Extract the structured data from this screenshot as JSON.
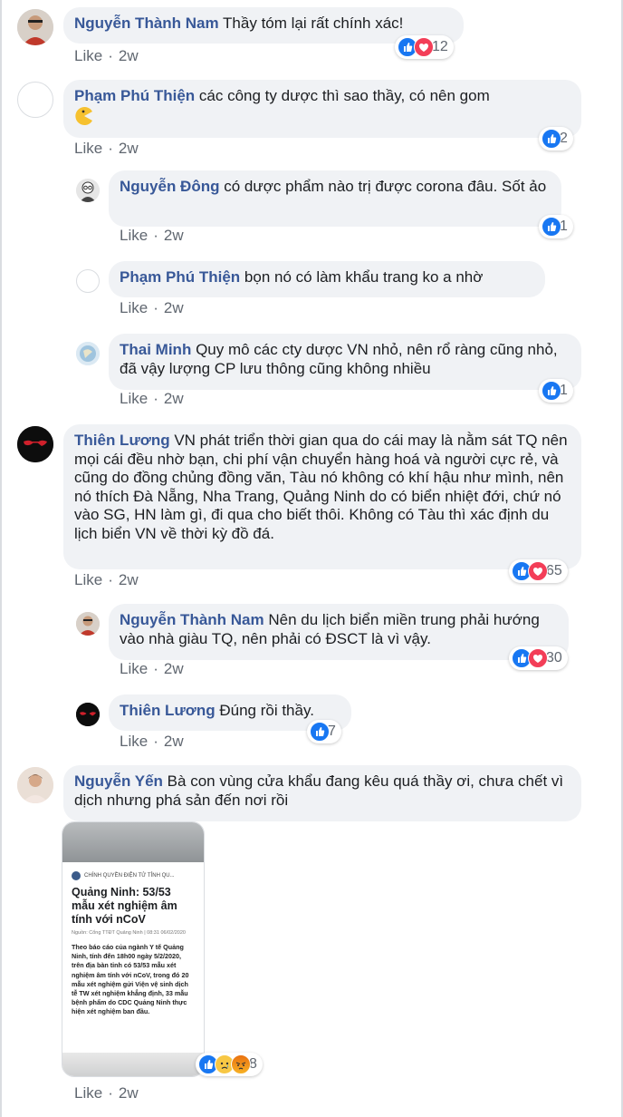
{
  "colors": {
    "name": "#385898",
    "like": "#1877f2",
    "love": "#f33e58",
    "meta": "#606770",
    "bubble": "#f0f2f5"
  },
  "comments": [
    {
      "name": "Nguyễn Thành Nam",
      "text": "Thầy tóm lại rất chính xác!",
      "like": "Like",
      "time": "2w",
      "reactions": [
        "like",
        "love"
      ],
      "count": "12"
    },
    {
      "name": "Phạm Phú Thiện",
      "text": "các công ty dược thì sao thầy, có nên gom",
      "emoji": "pacman-icon",
      "like": "Like",
      "time": "2w",
      "reactions": [
        "like"
      ],
      "count": "2"
    },
    {
      "name": "Nguyễn Đông",
      "text": "có dược phẩm nào trị được corona đâu. Sốt ảo",
      "like": "Like",
      "time": "2w",
      "reactions": [
        "like"
      ],
      "count": "1"
    },
    {
      "name": "Phạm Phú Thiện",
      "text": "bọn nó có làm khẩu trang ko a nhờ",
      "like": "Like",
      "time": "2w"
    },
    {
      "name": "Thai Minh",
      "text": "Quy mô các cty dược VN nhỏ, nên rổ ràng cũng nhỏ, đã vậy lượng CP lưu thông cũng không nhiều",
      "like": "Like",
      "time": "2w",
      "reactions": [
        "like"
      ],
      "count": "1"
    },
    {
      "name": "Thiên Lương",
      "text": "VN phát triển thời gian qua do cái may là nằm sát TQ nên mọi cái đều nhờ bạn, chi phí vận chuyển hàng hoá và người cực rẻ, và cũng do đồng chủng đồng văn, Tàu nó không có khí hậu như mình, nên nó thích Đà Nẵng, Nha Trang, Quảng Ninh do có biển nhiệt đới, chứ nó vào SG, HN làm gì, đi qua cho biết thôi. Không có Tàu thì xác định du lịch biển VN về thời kỳ đồ đá.",
      "like": "Like",
      "time": "2w",
      "reactions": [
        "like",
        "love"
      ],
      "count": "65"
    },
    {
      "name": "Nguyễn Thành Nam",
      "text": "Nên du lịch biển miền trung phải hướng vào nhà giàu TQ, nên phải có ĐSCT là vì vậy.",
      "like": "Like",
      "time": "2w",
      "reactions": [
        "like",
        "love"
      ],
      "count": "30"
    },
    {
      "name": "Thiên Lương",
      "text": "Đúng rồi thầy.",
      "like": "Like",
      "time": "2w",
      "reactions": [
        "like"
      ],
      "count": "7"
    },
    {
      "name": "Nguyễn Yến",
      "text": "Bà con vùng cửa khẩu đang kêu quá thầy ơi, chưa chết vì dịch nhưng phá sản đến nơi rồi",
      "like": "Like",
      "time": "2w",
      "reactions": [
        "like",
        "sad",
        "angry"
      ],
      "count": "8"
    }
  ],
  "attachment": {
    "source": "CHÍNH QUYỀN ĐIỆN TỬ TỈNH QU...",
    "title": "Quảng Ninh: 53/53 mẫu xét nghiệm âm tính với nCoV",
    "sub": "Nguồn: Cổng TTĐT Quảng Ninh | 08:31 06/02/2020",
    "body": "Theo báo cáo của ngành Y tế Quảng Ninh, tính đến 18h00 ngày 5/2/2020, trên địa bàn tỉnh có 53/53 mẫu xét nghiệm âm tính với nCoV, trong đó 20 mẫu xét nghiệm gửi Viện vệ sinh dịch tễ TW xét nghiệm khẳng định, 33 mẫu bệnh phẩm do CDC Quảng Ninh thực hiện xét nghiệm ban đầu."
  }
}
